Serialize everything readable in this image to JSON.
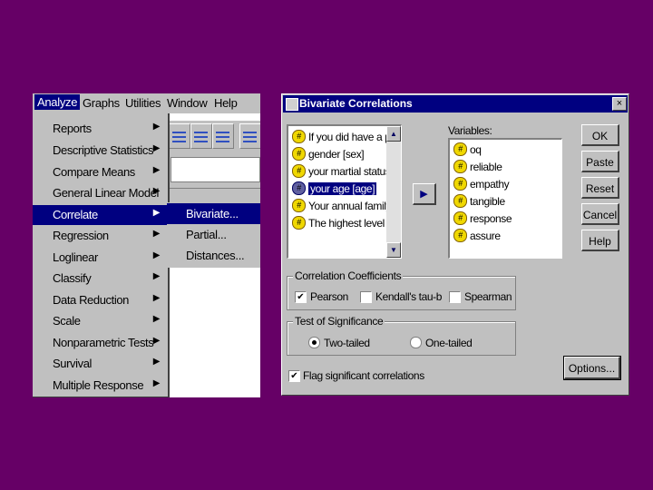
{
  "menubar": {
    "items": [
      "Analyze",
      "Graphs",
      "Utilities",
      "Window",
      "Help"
    ]
  },
  "analyze_menu": {
    "items": [
      {
        "label": "Reports"
      },
      {
        "label": "Descriptive Statistics"
      },
      {
        "label": "Compare Means"
      },
      {
        "label": "General Linear Model"
      },
      {
        "label": "Correlate",
        "selected": true
      },
      {
        "label": "Regression"
      },
      {
        "label": "Loglinear"
      },
      {
        "label": "Classify"
      },
      {
        "label": "Data Reduction"
      },
      {
        "label": "Scale"
      },
      {
        "label": "Nonparametric Tests"
      },
      {
        "label": "Survival"
      },
      {
        "label": "Multiple Response"
      }
    ]
  },
  "correlate_submenu": {
    "items": [
      {
        "label": "Bivariate...",
        "selected": true
      },
      {
        "label": "Partial..."
      },
      {
        "label": "Distances..."
      }
    ]
  },
  "dialog": {
    "title": "Bivariate Correlations",
    "close": "×",
    "source_list": [
      "If you did have a pro",
      "gender [sex]",
      "your martial status  [",
      "your age [age]",
      "Your annual family in",
      "The highest level of"
    ],
    "source_selected": "your age [age]",
    "variables_label": "Variables:",
    "variables_list": [
      "oq",
      "reliable",
      "empathy",
      "tangible",
      "response",
      "assure"
    ],
    "buttons": [
      "OK",
      "Paste",
      "Reset",
      "Cancel",
      "Help"
    ],
    "coefficients": {
      "label": "Correlation Coefficients",
      "pearson": "Pearson",
      "pearson_checked": true,
      "kendall": "Kendall's tau-b",
      "kendall_checked": false,
      "spearman": "Spearman",
      "spearman_checked": false
    },
    "significance": {
      "label": "Test of Significance",
      "two_tailed": "Two-tailed",
      "one_tailed": "One-tailed",
      "selected": "two_tailed"
    },
    "flag_label": "Flag significant correlations",
    "flag_checked": true,
    "options_button": "Options..."
  }
}
